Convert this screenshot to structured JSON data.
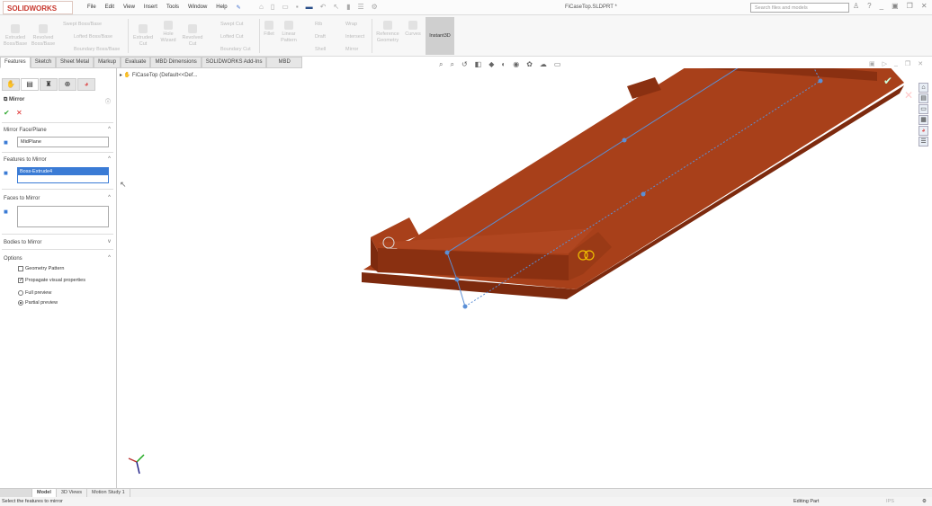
{
  "app": {
    "logo": "SOLIDWORKS",
    "title": "FiCaseTop.SLDPRT *",
    "search_placeholder": "Search files and models"
  },
  "menu": [
    "File",
    "Edit",
    "View",
    "Insert",
    "Tools",
    "Window",
    "Help"
  ],
  "ribbon": [
    {
      "label": "Extruded Boss/Base"
    },
    {
      "label": "Revolved Boss/Base"
    },
    {
      "label": "Swept Boss/Base"
    },
    {
      "label": "Lofted Boss/Base"
    },
    {
      "label": "Boundary Boss/Base"
    },
    {
      "label": "Extruded Cut"
    },
    {
      "label": "Hole Wizard"
    },
    {
      "label": "Revolved Cut"
    },
    {
      "label": "Swept Cut"
    },
    {
      "label": "Lofted Cut"
    },
    {
      "label": "Boundary Cut"
    },
    {
      "label": "Fillet"
    },
    {
      "label": "Linear Pattern"
    },
    {
      "label": "Rib"
    },
    {
      "label": "Draft"
    },
    {
      "label": "Shell"
    },
    {
      "label": "Wrap"
    },
    {
      "label": "Intersect"
    },
    {
      "label": "Mirror"
    },
    {
      "label": "Reference Geometry"
    },
    {
      "label": "Curves"
    },
    {
      "label": "Instant3D"
    }
  ],
  "tabs": [
    "Features",
    "Sketch",
    "Sheet Metal",
    "Markup",
    "Evaluate",
    "MBD Dimensions",
    "SOLIDWORKS Add-Ins",
    "MBD"
  ],
  "tree": {
    "root": "FiCaseTop  (Default<<Def..."
  },
  "property_manager": {
    "title": "Mirror",
    "ok": "✔",
    "cancel": "✕",
    "mirror_face_plane": {
      "label": "Mirror Face/Plane",
      "value": "MidPlane"
    },
    "features_to_mirror": {
      "label": "Features to Mirror",
      "value": "Boss-Extrude4"
    },
    "faces_to_mirror": {
      "label": "Faces to Mirror",
      "value": ""
    },
    "bodies_to_mirror": {
      "label": "Bodies to Mirror"
    },
    "options": {
      "label": "Options",
      "geometry_pattern": {
        "label": "Geometry Pattern",
        "checked": false
      },
      "propagate": {
        "label": "Propagate visual properties",
        "checked": true
      },
      "full_preview": {
        "label": "Full preview",
        "selected": false
      },
      "partial_preview": {
        "label": "Partial preview",
        "selected": true
      }
    }
  },
  "bottom_tabs": [
    "Model",
    "3D Views",
    "Motion Study 1"
  ],
  "status": {
    "message": "Select the features to mirror",
    "mode": "Editing Part",
    "units": "IPS"
  },
  "colors": {
    "model": "#9e3412",
    "plane": "#5b8fd6",
    "brand": "#c8372d",
    "selection": "#3a7bd5"
  }
}
